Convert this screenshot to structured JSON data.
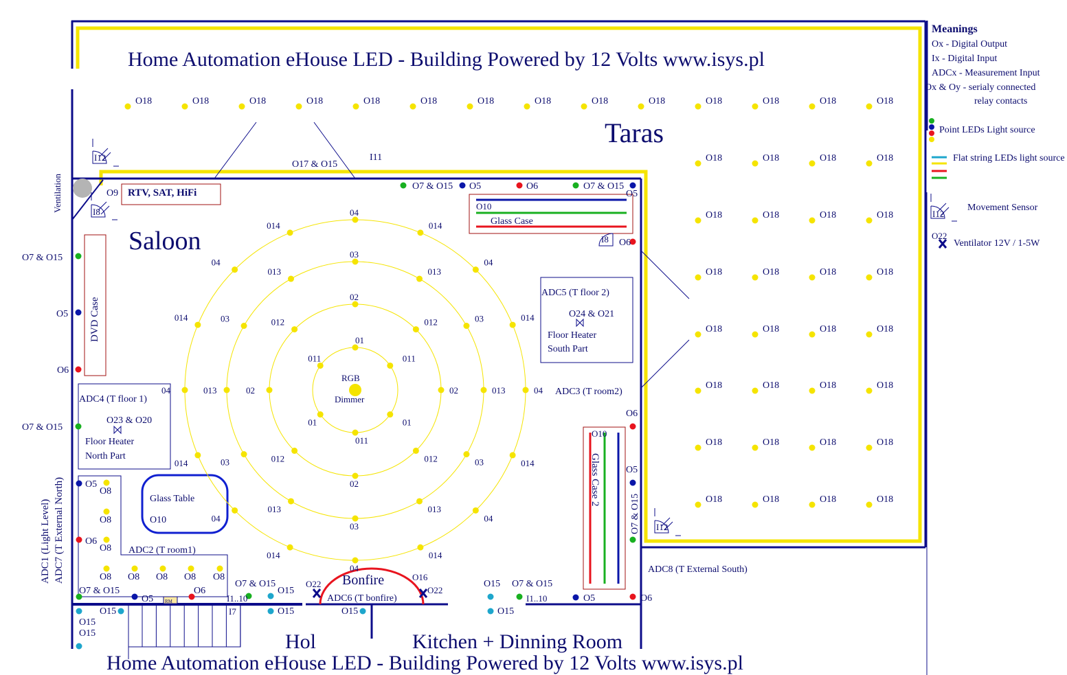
{
  "title_top": "Home Automation eHouse LED - Building Powered by 12 Volts  www.isys.pl",
  "title_bottom": "Home Automation eHouse LED - Building Powered by 12 Volts  www.isys.pl",
  "rooms": {
    "taras": "Taras",
    "saloon": "Saloon",
    "hol": "Hol",
    "kitchen": "Kitchen + Dinning Room"
  },
  "colors": {
    "wall": "#0c0c8a",
    "green": "#18b020",
    "blue": "#0a16a8",
    "red": "#e8141e",
    "yellow": "#f5e400",
    "cyan": "#1ea6cc",
    "sensor_gray": "#b4b4b4"
  },
  "legend": {
    "heading": "Meanings",
    "lines": [
      "Ox - Digital Output",
      "Ix - Digital Input",
      "ADCx - Measurement Input",
      "Ox & Oy - serialy connected",
      "relay contacts"
    ],
    "point_leds": "Point  LEDs Light source",
    "flat_string": "Flat string LEDs light source",
    "sensor_label": "I12",
    "movement_sensor": "Movement Sensor",
    "ventilator_label": "O22",
    "ventilator": "Ventilator 12V / 1-5W"
  },
  "taras_lamp_label": "O18",
  "rgb": {
    "line1": "RGB",
    "line2": "Dimmer"
  },
  "rings": [
    {
      "labels": [
        "01",
        "011",
        "01",
        "011",
        "01",
        "011"
      ]
    },
    {
      "labels": [
        "02",
        "012",
        "02",
        "012",
        "02",
        "012",
        "02",
        "012"
      ]
    },
    {
      "labels": [
        "03",
        "013",
        "03",
        "013",
        "03",
        "013",
        "03",
        "013",
        "03",
        "013",
        "03",
        "013"
      ]
    },
    {
      "labels": [
        "04",
        "014",
        "04",
        "014",
        "04",
        "014",
        "04",
        "014",
        "04",
        "014",
        "04",
        "014",
        "04",
        "014",
        "04",
        "014"
      ]
    }
  ],
  "points": [
    {
      "label": "O7 & O15",
      "color": "green"
    },
    {
      "label": "O5",
      "color": "blue"
    },
    {
      "label": "O6",
      "color": "red"
    },
    {
      "label": "O7 & O15",
      "color": "green"
    },
    {
      "label": "O5",
      "color": "blue"
    },
    {
      "label": "O6",
      "color": "red"
    },
    {
      "label": "O7 & O15",
      "color": "green"
    },
    {
      "label": "O5",
      "color": "blue"
    },
    {
      "label": "O6",
      "color": "red"
    },
    {
      "label": "O7 & O15",
      "color": "green"
    },
    {
      "label": "O5",
      "color": "blue"
    },
    {
      "label": "O8",
      "color": "yellow"
    },
    {
      "label": "O8",
      "color": "yellow"
    },
    {
      "label": "O6",
      "color": "red"
    },
    {
      "label": "O8",
      "color": "yellow"
    },
    {
      "label": "O8",
      "color": "yellow"
    },
    {
      "label": "O8",
      "color": "yellow"
    },
    {
      "label": "O8",
      "color": "yellow"
    },
    {
      "label": "O8",
      "color": "yellow"
    },
    {
      "label": "O8",
      "color": "yellow"
    },
    {
      "label": "O7 & O15",
      "color": "green"
    },
    {
      "label": "O5",
      "color": "blue"
    },
    {
      "label": "O6",
      "color": "red"
    },
    {
      "label": "O7 & O15",
      "color": "green"
    },
    {
      "label": "O15",
      "color": "cyan"
    },
    {
      "label": "O15",
      "color": "cyan"
    },
    {
      "label": "O15",
      "color": "cyan"
    },
    {
      "label": "O15",
      "color": "cyan"
    },
    {
      "label": "O15",
      "color": "cyan"
    },
    {
      "label": "O15",
      "color": "cyan"
    },
    {
      "label": "O15",
      "color": "cyan"
    },
    {
      "label": "O7 & O15",
      "color": "green"
    },
    {
      "label": "O15",
      "color": "cyan"
    },
    {
      "label": "O5",
      "color": "blue"
    },
    {
      "label": "O6",
      "color": "red"
    },
    {
      "label": "O6",
      "color": "red"
    },
    {
      "label": "O5",
      "color": "blue"
    },
    {
      "label": "O7 & O15",
      "color": "green"
    }
  ],
  "labels": [
    "O9",
    "RTV, SAT, HiFi",
    "I8",
    "I8",
    "I12",
    "I12",
    "O17 & O15",
    "I11",
    "ADC5 (T floor 2)",
    "O24 & O21",
    "Floor Heater",
    "South Part",
    "ADC3 (T room2)",
    "ADC4 (T floor 1)",
    "O23 & O20",
    "Floor Heater",
    "North Part",
    "Glass Table",
    "O10",
    "ADC2 (T room1)",
    "ADC8 (T External South)",
    "ADC1 (Light Level)",
    "ADC7 (T External North)",
    "Ventilation",
    "DVD Case",
    "O10",
    "Glass Case",
    "O10",
    "Glass Case 2",
    "Bonfire",
    "ADC6 (T bonfire)",
    "O22",
    "O16",
    "O22",
    "I7",
    "I1..10",
    "I1..10",
    "RM"
  ]
}
